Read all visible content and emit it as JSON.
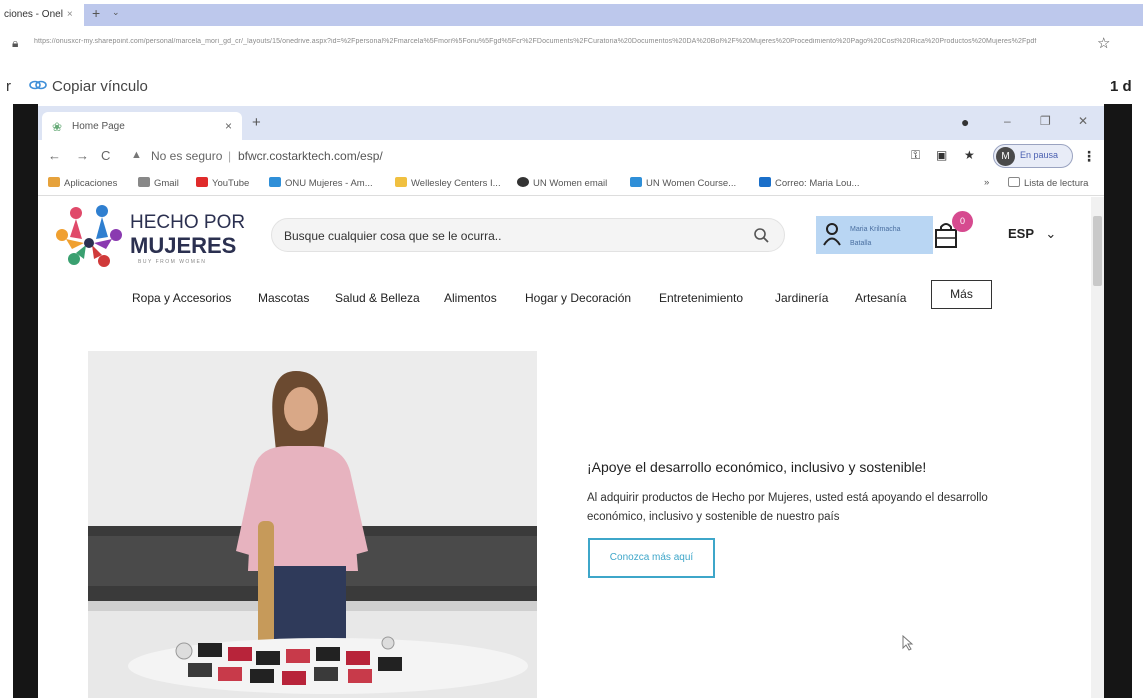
{
  "outer": {
    "tab_title": "ciones - Onel",
    "tab_close": "×",
    "new_tab": "+",
    "tab_menu": "⌄",
    "url": "https://onusxcr-my.sharepoint.com/personal/marcela_mori_gd_cr/_layouts/15/onedrive.aspx?id=%2Fpersonal%2Fmarcela%5Fmori%5Fonu%5Fgd%5Fcr%2FDocuments%2FCuratoria%20Documentos%20DA%20Bol%2F%20Mujeres%20Procedimiento%20Pago%20Cost%20Rica%20Productos%20Mujeres%2Fpdf",
    "copy_prefix": "r",
    "copy_label": "Copiar vínculo",
    "page_count": "1 d"
  },
  "inner_browser": {
    "tab_title": "Home Page",
    "tab_close": "×",
    "new_tab": "+",
    "not_secure": "No es seguro",
    "url": "bfwcr.costarktech.com/esp/",
    "profile_initial": "M",
    "profile_status": "En pausa",
    "bookmarks": [
      {
        "label": "Aplicaciones",
        "color": "#e6a23c"
      },
      {
        "label": "Gmail",
        "color": "#888888"
      },
      {
        "label": "YouTube",
        "color": "#e02b2b"
      },
      {
        "label": "ONU Mujeres - Am...",
        "color": "#2f8fd8"
      },
      {
        "label": "Wellesley Centers I...",
        "color": "#f0c040"
      },
      {
        "label": "UN Women email",
        "color": "#333333"
      },
      {
        "label": "UN Women Course...",
        "color": "#2f8fd8"
      },
      {
        "label": "Correo: Maria Lou...",
        "color": "#1a6fc9"
      }
    ],
    "more_bookmarks": "»",
    "reading_list": "Lista de lectura"
  },
  "site": {
    "logo_line1": "HECHO POR",
    "logo_line2": "MUJERES",
    "logo_tagline": "BUY FROM WOMEN",
    "search_placeholder": "Busque cualquier cosa que se le ocurra..",
    "user_name_line1": "Maria Krilmacha",
    "user_name_line2": "Batalla",
    "cart_count": "0",
    "language": "ESP",
    "menu": [
      "Ropa y Accesorios",
      "Mascotas",
      "Salud & Belleza",
      "Alimentos",
      "Hogar y Decoración",
      "Entretenimiento",
      "Jardinería",
      "Artesanía"
    ],
    "menu_more": "Más",
    "hero_title": "¡Apoye el desarrollo económico, inclusivo y sostenible!",
    "hero_body": "Al adquirir productos de Hecho por Mujeres, usted está apoyando el desarrollo económico, inclusivo y sostenible de nuestro país",
    "hero_cta": "Conozca más aquí"
  },
  "colors": {
    "outer_tab_strip": "#bdc8ec",
    "accent_cta": "#3ea6c9",
    "cart_badge": "#d64a8f",
    "user_box": "#b9d6f3"
  }
}
